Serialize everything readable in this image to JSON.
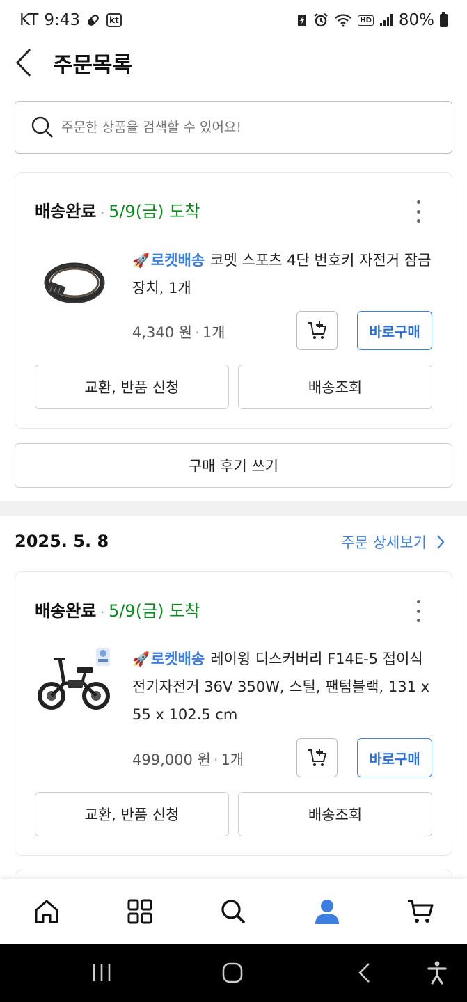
{
  "status_bar": {
    "carrier": "KT",
    "time": "9:43",
    "kt_badge": "kt",
    "hd_badge": "HD",
    "battery": "80%"
  },
  "header": {
    "title": "주문목록"
  },
  "search": {
    "placeholder": "주문한 상품을 검색할 수 있어요!"
  },
  "orders": [
    {
      "status": "배송완료",
      "arrival": "5/9(금) 도착",
      "rocket_label": "로켓배송",
      "product_name": "코멧 스포츠 4단 번호키 자전거 잠금장치, 1개",
      "price": "4,340 원",
      "quantity": "1개",
      "buy_label": "바로구매",
      "exchange_label": "교환, 반품 신청",
      "tracking_label": "배송조회",
      "thumb_icon": "cable-lock-image"
    },
    {
      "status": "배송완료",
      "arrival": "5/9(금) 도착",
      "rocket_label": "로켓배송",
      "product_name": "레이윙 디스커버리 F14E-5 접이식 전기자전거 36V 350W, 스틸, 팬텀블랙, 131 x 55 x 102.5 cm",
      "price": "499,000 원",
      "quantity": "1개",
      "buy_label": "바로구매",
      "exchange_label": "교환, 반품 신청",
      "tracking_label": "배송조회",
      "thumb_icon": "electric-bike-image"
    }
  ],
  "review_label": "구매 후기 쓰기",
  "order_group": {
    "date": "2025. 5. 8",
    "detail_label": "주문 상세보기"
  },
  "tabbar": {
    "items": [
      "home-icon",
      "categories-icon",
      "search-icon",
      "my-page-icon",
      "cart-icon"
    ],
    "active": "my-page-icon"
  },
  "colors": {
    "accent": "#3d7fe0",
    "arrival_green": "#0a8a1f"
  }
}
